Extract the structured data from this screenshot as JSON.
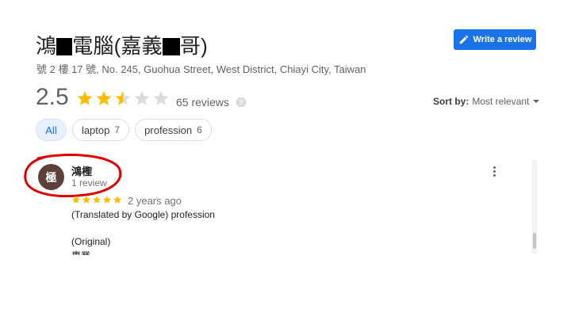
{
  "place": {
    "title_part1": "鴻",
    "title_part2": "電腦(嘉義",
    "title_part3": "哥)",
    "address": "號 2 樓 17 號, No. 245, Guohua Street, West District, Chiayi City, Taiwan"
  },
  "write_review": {
    "label": "Write a review",
    "icon": "pencil-icon"
  },
  "summary": {
    "rating": "2.5",
    "stars_value": 2.5,
    "stars_max": 5,
    "review_count": "65 reviews",
    "colors": {
      "star_filled": "#fbbc04",
      "star_empty": "#dadce0"
    }
  },
  "sort": {
    "label": "Sort by:",
    "value": "Most relevant"
  },
  "chips": [
    {
      "label": "All",
      "count": ""
    },
    {
      "label": "laptop",
      "count": "7"
    },
    {
      "label": "profession",
      "count": "6"
    }
  ],
  "review": {
    "avatar_initial": "極",
    "avatar_color": "#5d4037",
    "name": "鴻檉",
    "meta": "1 review",
    "stars": 5,
    "date": "2 years ago",
    "text": "(Translated by Google) profession",
    "original_label": "(Original)",
    "original_text": "專業"
  },
  "accent": "#1a73e8"
}
